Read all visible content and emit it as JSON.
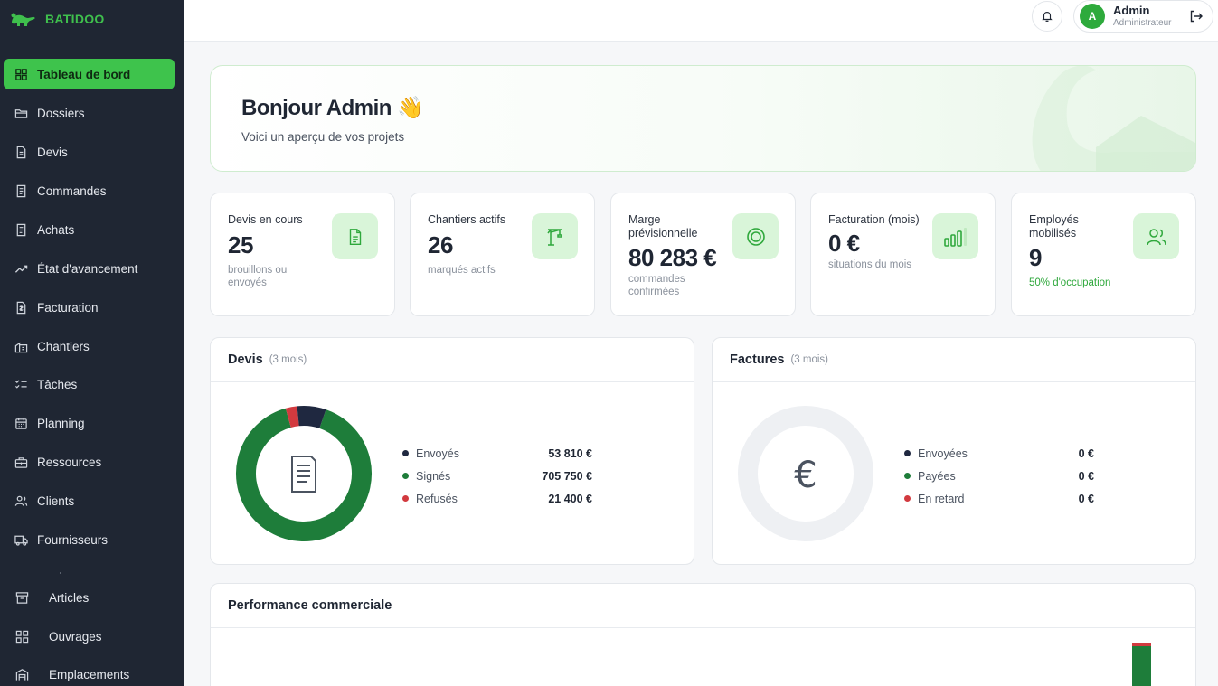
{
  "brand": {
    "name": "BATIDOO",
    "color": "#3fbf4d"
  },
  "sidebar": {
    "items": [
      {
        "label": "Tableau de bord",
        "icon": "grid-icon",
        "active": true
      },
      {
        "label": "Dossiers",
        "icon": "folder-icon"
      },
      {
        "label": "Devis",
        "icon": "document-icon"
      },
      {
        "label": "Commandes",
        "icon": "receipt-icon"
      },
      {
        "label": "Achats",
        "icon": "receipt-icon"
      },
      {
        "label": "État d'avancement",
        "icon": "trend-icon"
      },
      {
        "label": "Facturation",
        "icon": "invoice-icon"
      },
      {
        "label": "Chantiers",
        "icon": "building-icon"
      },
      {
        "label": "Tâches",
        "icon": "checklist-icon"
      },
      {
        "label": "Planning",
        "icon": "calendar-icon"
      },
      {
        "label": "Ressources",
        "icon": "briefcase-icon"
      },
      {
        "label": "Clients",
        "icon": "users-icon"
      },
      {
        "label": "Fournisseurs",
        "icon": "truck-icon"
      },
      {
        "label": "Articles",
        "icon": "archive-icon"
      },
      {
        "label": "Ouvrages",
        "icon": "blocks-icon"
      },
      {
        "label": "Emplacements",
        "icon": "warehouse-icon"
      }
    ]
  },
  "topbar": {
    "user": {
      "initial": "A",
      "name": "Admin",
      "role": "Administrateur"
    }
  },
  "welcome": {
    "title": "Bonjour Admin 👋",
    "subtitle": "Voici un aperçu de vos projets"
  },
  "stats": [
    {
      "label": "Devis en cours",
      "value": "25",
      "sub": "brouillons ou envoyés",
      "icon": "document-icon"
    },
    {
      "label": "Chantiers actifs",
      "value": "26",
      "sub": "marqués actifs",
      "icon": "crane-icon"
    },
    {
      "label": "Marge prévisionnelle",
      "value": "80 283 €",
      "sub": "commandes confirmées",
      "icon": "target-icon"
    },
    {
      "label": "Facturation (mois)",
      "value": "0 €",
      "sub": "situations du mois",
      "icon": "bar-chart-icon"
    },
    {
      "label": "Employés mobilisés",
      "value": "9",
      "sub": "50% d'occupation",
      "icon": "users-icon"
    }
  ],
  "devis": {
    "title": "Devis",
    "note": "(3 mois)",
    "legend": [
      {
        "name": "Envoyés",
        "value": "53 810 €",
        "color": "#1f2840"
      },
      {
        "name": "Signés",
        "value": "705 750 €",
        "color": "#1e7d3a"
      },
      {
        "name": "Refusés",
        "value": "21 400 €",
        "color": "#d23a3f"
      }
    ]
  },
  "factures": {
    "title": "Factures",
    "note": "(3 mois)",
    "center_symbol": "€",
    "legend": [
      {
        "name": "Envoyées",
        "value": "0 €",
        "color": "#1f2840"
      },
      {
        "name": "Payées",
        "value": "0 €",
        "color": "#1e7d3a"
      },
      {
        "name": "En retard",
        "value": "0 €",
        "color": "#d23a3f"
      }
    ]
  },
  "performance": {
    "title": "Performance commerciale"
  },
  "chart_data": [
    {
      "type": "pie",
      "labels": [
        "Envoyés",
        "Signés",
        "Refusés"
      ],
      "values": [
        53810,
        705750,
        21400
      ],
      "colors": [
        "#1f2840",
        "#1e7d3a",
        "#d23a3f"
      ]
    },
    {
      "type": "pie",
      "labels": [
        "Envoyées",
        "Payées",
        "En retard"
      ],
      "values": [
        0,
        0,
        0
      ],
      "colors": [
        "#1f2840",
        "#1e7d3a",
        "#d23a3f"
      ]
    }
  ]
}
